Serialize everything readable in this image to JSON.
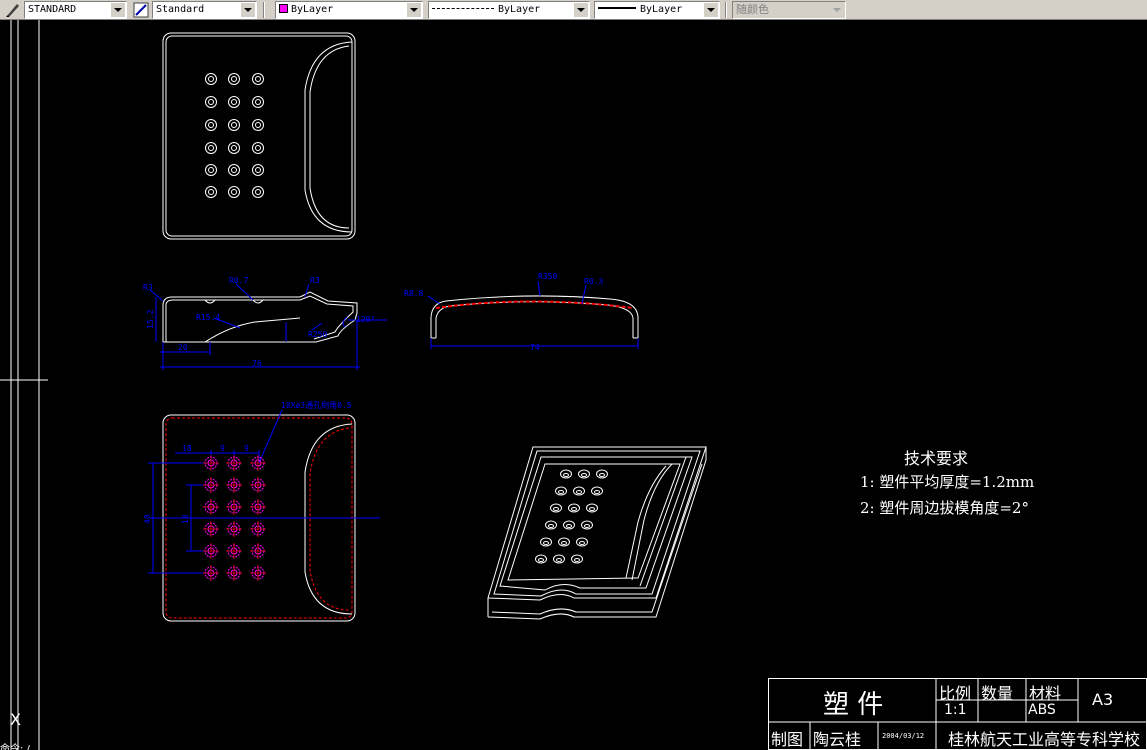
{
  "toolbar": {
    "text_style": "STANDARD",
    "dim_style": "Standard",
    "layer": "ByLayer",
    "linetype": "ByLayer",
    "lineweight": "ByLayer",
    "plot_style": "随颜色",
    "colors": {
      "layer_swatch": "#ff00ff",
      "background": "#d4d0c8"
    }
  },
  "drawing": {
    "background": "#000000",
    "line_color": "#ffffff",
    "dimension_color": "#0000ff",
    "hidden_color": "#ff0000",
    "hole_color": "#ff00ff",
    "dimensions": {
      "r3_a": "R3",
      "r0_7": "R0.7",
      "r3_b": "R3",
      "height_15_2": "15.2",
      "r15_4": "R15.4",
      "r250": "R250",
      "dim_20": "20",
      "dim_76": "76",
      "dim_120": "120°",
      "r8_8": "R8.8",
      "r350": "R350",
      "r0_3": "R0.3",
      "dim_74": "74",
      "dim_18": "18",
      "dim_9a": "9",
      "dim_9b": "9",
      "dim_40": "40",
      "dim_18v": "18",
      "hole_note": "18Xø3通孔倒角0.5",
      "x_label": "X"
    },
    "tech_requirements": {
      "title": "技术要求",
      "items": [
        "1:  塑件平均厚度=1.2mm",
        "2:  塑件周边拔模角度=2°"
      ]
    },
    "title_block": {
      "part_name": "塑    件",
      "scale_label": "比例",
      "qty_label": "数量",
      "material_label": "材料",
      "scale_value": "1:1",
      "material_value": "ABS",
      "sheet": "A3",
      "drawn_label": "制图",
      "drawn_by": "陶云桂",
      "date": "2004/03/12",
      "school": "桂林航天工业高等专科学校"
    }
  },
  "command_line": {
    "prompt": "命令: /"
  }
}
